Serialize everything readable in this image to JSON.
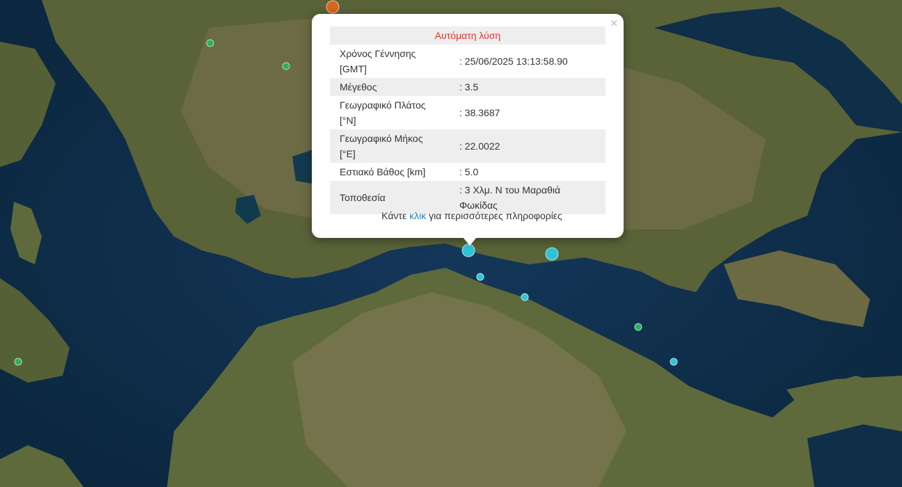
{
  "popup": {
    "close_label": "×",
    "title": "Αυτόματη λύση",
    "rows": [
      {
        "label": "Χρόνος Γέννησης [GMT]",
        "value": ": 25/06/2025 13:13:58.90"
      },
      {
        "label": "Μέγεθος",
        "value": ": 3.5"
      },
      {
        "label": "Γεωγραφικό Πλάτος [°N]",
        "value": ": 38.3687"
      },
      {
        "label": "Γεωγραφικό Μήκος [°E]",
        "value": ": 22.0022"
      },
      {
        "label": "Εστιακό Βάθος [km]",
        "value": ": 5.0"
      },
      {
        "label": "Τοποθεσία",
        "value": ": 3 Χλμ. Ν του Μαραθιά Φωκίδας"
      }
    ],
    "more_prefix": "Κάντε",
    "more_link": "κλικ",
    "more_suffix": "για περισσότερες πληροφορίες"
  },
  "colors": {
    "sea": "#0f2e47",
    "land": "#5e6a3c",
    "mountain": "#857a55",
    "marker_cyan": "#2ec4d6",
    "marker_green": "#2fae5c",
    "marker_orange": "#d9671c",
    "title_red": "#e53030",
    "link_blue": "#1a83c9"
  }
}
